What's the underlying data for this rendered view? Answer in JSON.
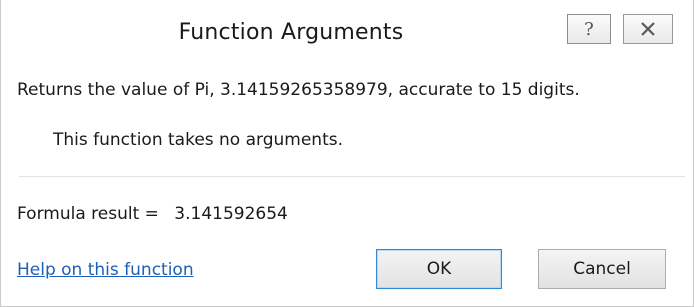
{
  "dialog": {
    "title": "Function Arguments",
    "help_glyph": "?",
    "close_icon": "close-icon"
  },
  "content": {
    "description": "Returns the value of Pi, 3.14159265358979, accurate to 15 digits.",
    "no_args_text": "This function takes no arguments.",
    "formula_result_label": "Formula result =",
    "formula_result_value": "3.141592654"
  },
  "footer": {
    "help_link": "Help on this function",
    "ok_label": "OK",
    "cancel_label": "Cancel"
  },
  "colors": {
    "link": "#1e5fb8",
    "default_button_border": "#2f8ad8"
  }
}
